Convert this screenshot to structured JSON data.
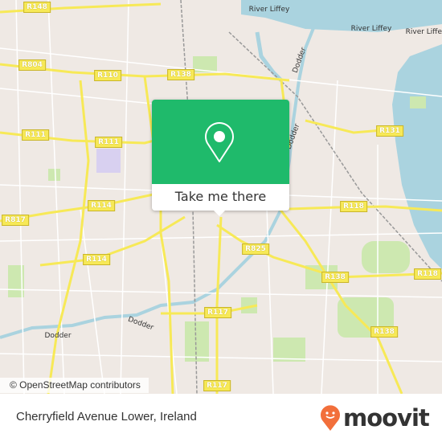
{
  "map": {
    "road_labels": [
      "R148",
      "R804",
      "R110",
      "R138",
      "R111",
      "R111",
      "R114",
      "R817",
      "R114",
      "R825",
      "R117",
      "R117",
      "R138",
      "R131",
      "R118",
      "R118",
      "R138"
    ],
    "water_labels": [
      "River Liffey",
      "River Liffey",
      "River Liffey",
      "Dodder",
      "Dodder",
      "Dodder",
      "Dodder"
    ],
    "attribution": "© OpenStreetMap contributors",
    "colors": {
      "land": "#efe9e4",
      "water": "#aad3df",
      "park": "#cde8b0",
      "road": "#f7e957",
      "accent": "#1fba6b"
    }
  },
  "popup": {
    "icon": "map-pin-icon",
    "button_label": "Take me there"
  },
  "footer": {
    "place_name": "Cherryfield Avenue Lower, Ireland",
    "brand": "moovit",
    "brand_color": "#f26f3b"
  }
}
